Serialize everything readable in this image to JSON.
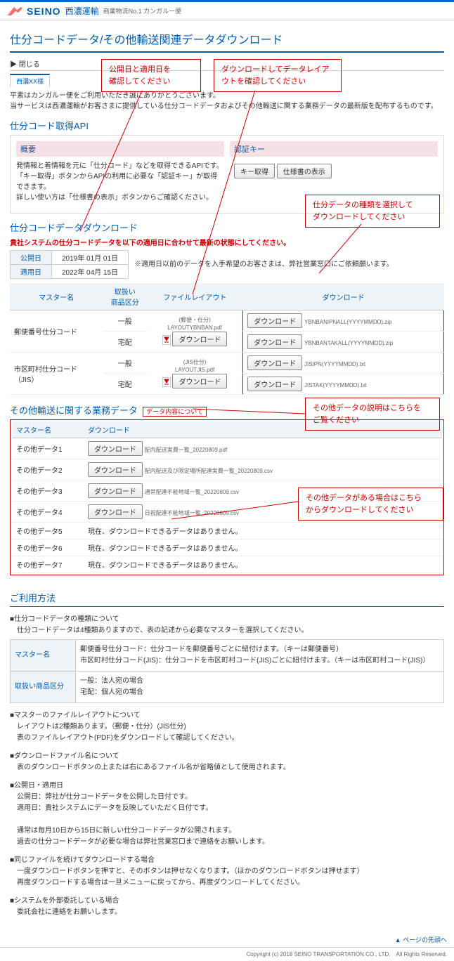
{
  "header": {
    "brand": "SEINO",
    "brand_jp": "西濃運輸",
    "tagline": "商業物流No.1 カンガルー便"
  },
  "page_title": "仕分コードデータ/その他輸送関連データダウンロード",
  "close_label": "閉じる",
  "tab_label": "西濃XX様",
  "intro_line1": "平素はカンガルー便をご利用いただき誠にありがとうございます。",
  "intro_line2": "当サービスは西濃運輸がお客さまに提供している仕分コードデータおよびその他輸送に関する業務データの最新版を配布するものです。",
  "api": {
    "title": "仕分コード取得API",
    "left_header": "概要",
    "summary1": "発情報と着情報を元に「仕分コード」などを取得できるAPIです。",
    "summary2": "「キー取得」ボタンからAPIの利用に必要な「認証キー」が取得できます。",
    "summary3": "詳しい使い方は「仕様書の表示」ボタンからご確認ください。",
    "right_header": "認証キー",
    "btn_key": "キー取得",
    "btn_spec": "仕様書の表示"
  },
  "dl": {
    "title": "仕分コードデータダウンロード",
    "notice": "貴社システムの仕分コードデータを以下の適用日に合わせて最新の状態にしてください。",
    "pub_label": "公開日",
    "pub_value": "2019年 01月 01日",
    "eff_label": "適用日",
    "eff_value": "2022年 04月 15日",
    "note": "※適用日以前のデータを入手希望のお客さまは、弊社営業窓口にご依頼願います。",
    "cols": {
      "master": "マスター名",
      "item": "取扱い\n商品区分",
      "layout": "ファイルレイアウト",
      "download": "ダウンロード"
    },
    "rows": [
      {
        "master": "郵便番号仕分コード",
        "sub": [
          {
            "item": "一般",
            "pdf_label": "(郵便・仕分)",
            "dl": "ダウンロード",
            "file": "YBNBANIPNALL(YYYYMMDD).zip"
          },
          {
            "item": "宅配",
            "dl": "ダウンロード",
            "file": "YBNBANTAKALL(YYYYMMDD).zip"
          }
        ],
        "layout_file": "LAYOUTYBNBAN.pdf",
        "btn": "ダウンロード"
      },
      {
        "master": "市区町村仕分コード\n（JIS）",
        "sub": [
          {
            "item": "一般",
            "pdf_label": "(JIS仕分)",
            "dl": "ダウンロード",
            "file": "JISIPN(YYYYMMDD).txt"
          },
          {
            "item": "宅配",
            "dl": "ダウンロード",
            "file": "JISTAK(YYYYMMDD).txt"
          }
        ],
        "layout_file": "LAYOUTJIS.pdf",
        "btn": "ダウンロード"
      }
    ]
  },
  "other": {
    "title": "その他輸送に関する業務データ",
    "about_link": "データ内容について",
    "cols": {
      "master": "マスター名",
      "download": "ダウンロード"
    },
    "rows": [
      {
        "name": "その他データ1",
        "btn": "ダウンロード",
        "file": "配内配送実費一覧_20220809.pdf"
      },
      {
        "name": "その他データ2",
        "btn": "ダウンロード",
        "file": "配内配送及び限定場所配達実費一覧_20220809.csv"
      },
      {
        "name": "その他データ3",
        "btn": "ダウンロード",
        "file": "通常配達不能地域一覧_20220809.csv"
      },
      {
        "name": "その他データ4",
        "btn": "ダウンロード",
        "file": "日祝配達不能地域一覧_20220809.csv"
      },
      {
        "name": "その他データ5",
        "text": "現在、ダウンロードできるデータはありません。"
      },
      {
        "name": "その他データ6",
        "text": "現在、ダウンロードできるデータはありません。"
      },
      {
        "name": "その他データ7",
        "text": "現在、ダウンロードできるデータはありません。"
      }
    ]
  },
  "callouts": {
    "c1": "公開日と適用日を\n確認してください",
    "c2": "ダウンロードしてデータレイア\nウトを確認してください",
    "c3": "仕分データの種類を選択して\nダウンロードしてください",
    "c4": "その他データの説明はこちらを\nご覧ください",
    "c5": "その他データがある場合はこちら\nからダウンロードしてください"
  },
  "usage": {
    "title": "ご利用方法",
    "s1_title": "■仕分コードデータの種類について",
    "s1_text": "仕分コードデータは4種類ありますので、表の記述から必要なマスターを選択してください。",
    "s1_tbl_master_label": "マスター名",
    "s1_tbl_master_val": "郵便番号仕分コード：仕分コードを郵便番号ごとに紐付けます。（キーは郵便番号）\n市区町村仕分コード(JIS)：仕分コードを市区町村コード(JIS)ごとに紐付けます。（キーは市区町村コード(JIS)）",
    "s1_tbl_item_label": "取扱い商品区分",
    "s1_tbl_item_val": "一般：法人宛の場合\n宅配：個人宛の場合",
    "s2_title": "■マスターのファイルレイアウトについて",
    "s2_l1": "レイアウトは2種類あります。（郵便・仕分）(JIS仕分)",
    "s2_l2": "表のファイルレイアウト(PDF)をダウンロードして確認してください。",
    "s3_title": "■ダウンロードファイル名について",
    "s3_l1": "表のダウンロードボタンの上または右にあるファイル名が省略値として使用されます。",
    "s4_title": "■公開日・適用日",
    "s4_l1": "公開日：弊社が仕分コードデータを公開した日付です。",
    "s4_l2": "適用日：貴社システムにデータを反映していただく日付です。",
    "s4_l3": "通常は毎月10日から15日に新しい仕分コードデータが公開されます。",
    "s4_l4": "過去の仕分コードデータが必要な場合は弊社営業窓口まで連絡をお願いします。",
    "s5_title": "■同じファイルを続けてダウンロードする場合",
    "s5_l1": "一度ダウンロードボタンを押すと、そのボタンは押せなくなります。（ほかのダウンロードボタンは押せます）",
    "s5_l2": "再度ダウンロードする場合は一旦メニューに戻ってから、再度ダウンロードしてください。",
    "s6_title": "■システムを外部委託している場合",
    "s6_l1": "委託会社に連絡をお願いします。"
  },
  "footer_link": "▲ ページの先頭へ",
  "copyright": "Copyright (c) 2018 SEINO TRANSPORTATION CO., LTD.　All Rights Reserved."
}
